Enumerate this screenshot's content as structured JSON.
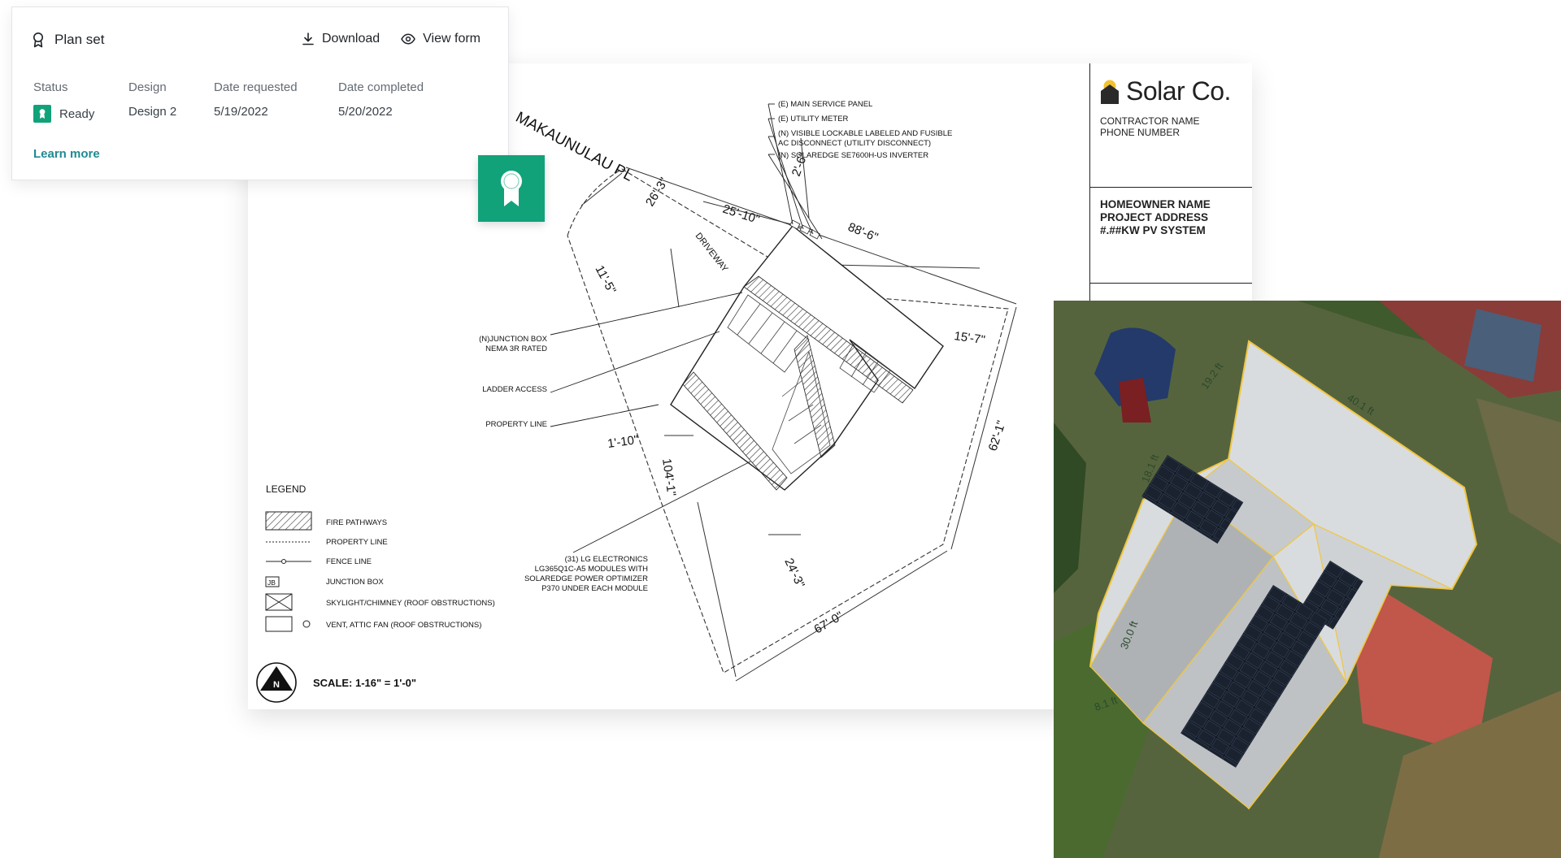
{
  "card": {
    "title": "Plan set",
    "download_label": "Download",
    "view_form_label": "View form",
    "columns": {
      "status": {
        "header": "Status",
        "value": "Ready"
      },
      "design": {
        "header": "Design",
        "value": "Design 2"
      },
      "date_requested": {
        "header": "Date requested",
        "value": "5/19/2022"
      },
      "date_completed": {
        "header": "Date completed",
        "value": "5/20/2022"
      }
    },
    "learn_more": "Learn more"
  },
  "sheet": {
    "street": "MAKAUNULAU PL",
    "driveway": "DRIVEWAY",
    "dimensions": {
      "d1": "2'-6\"",
      "d2": "26'-3\"",
      "d3": "25'-10\"",
      "d4": "88'-6\"",
      "d5": "11'-5\"",
      "d6": "15'-7\"",
      "d7": "62'-1\"",
      "d8": "1'-10\"",
      "d9": "104'-1\"",
      "d10": "24'-3\"",
      "d11": "67'-0\""
    },
    "callouts": {
      "main_panel": "(E) MAIN SERVICE PANEL",
      "utility_meter": "(E) UTILITY METER",
      "disconnect_1": "(N) VISIBLE LOCKABLE LABELED AND FUSIBLE",
      "disconnect_2": "AC DISCONNECT (UTILITY DISCONNECT)",
      "inverter": "(N) SOLAREDGE SE7600H-US INVERTER",
      "jbox_1": "(N)JUNCTION BOX",
      "jbox_2": "NEMA 3R RATED",
      "ladder": "LADDER ACCESS",
      "property_line": "PROPERTY LINE",
      "modules_1": "(31) LG ELECTRONICS",
      "modules_2": "LG365Q1C-A5 MODULES WITH",
      "modules_3": "SOLAREDGE POWER OPTIMIZER",
      "modules_4": "P370 UNDER EACH MODULE"
    },
    "legend": {
      "title": "LEGEND",
      "items": [
        "FIRE PATHWAYS",
        "PROPERTY LINE",
        "FENCE LINE",
        "JUNCTION BOX",
        "SKYLIGHT/CHIMNEY (ROOF OBSTRUCTIONS)",
        "VENT, ATTIC FAN (ROOF OBSTRUCTIONS)"
      ],
      "jb_mark": "JB"
    },
    "north": "N",
    "scale": "SCALE: 1-16\" = 1'-0\"",
    "titleblock": {
      "logo": "Solar Co.",
      "contractor_name": "CONTRACTOR NAME",
      "phone": "PHONE NUMBER",
      "homeowner": "HOMEOWNER NAME",
      "address": "PROJECT ADDRESS",
      "system": "#.##KW PV SYSTEM"
    }
  },
  "aerial": {
    "labels": {
      "a1": "19.2 ft",
      "a2": "40.1 ft",
      "a3": "18.1 ft",
      "a4": "30.0 ft",
      "a5": "8.1 ft"
    }
  },
  "colors": {
    "accent": "#12a27a",
    "link": "#1f8a93",
    "roof_outline": "#f0c640"
  }
}
